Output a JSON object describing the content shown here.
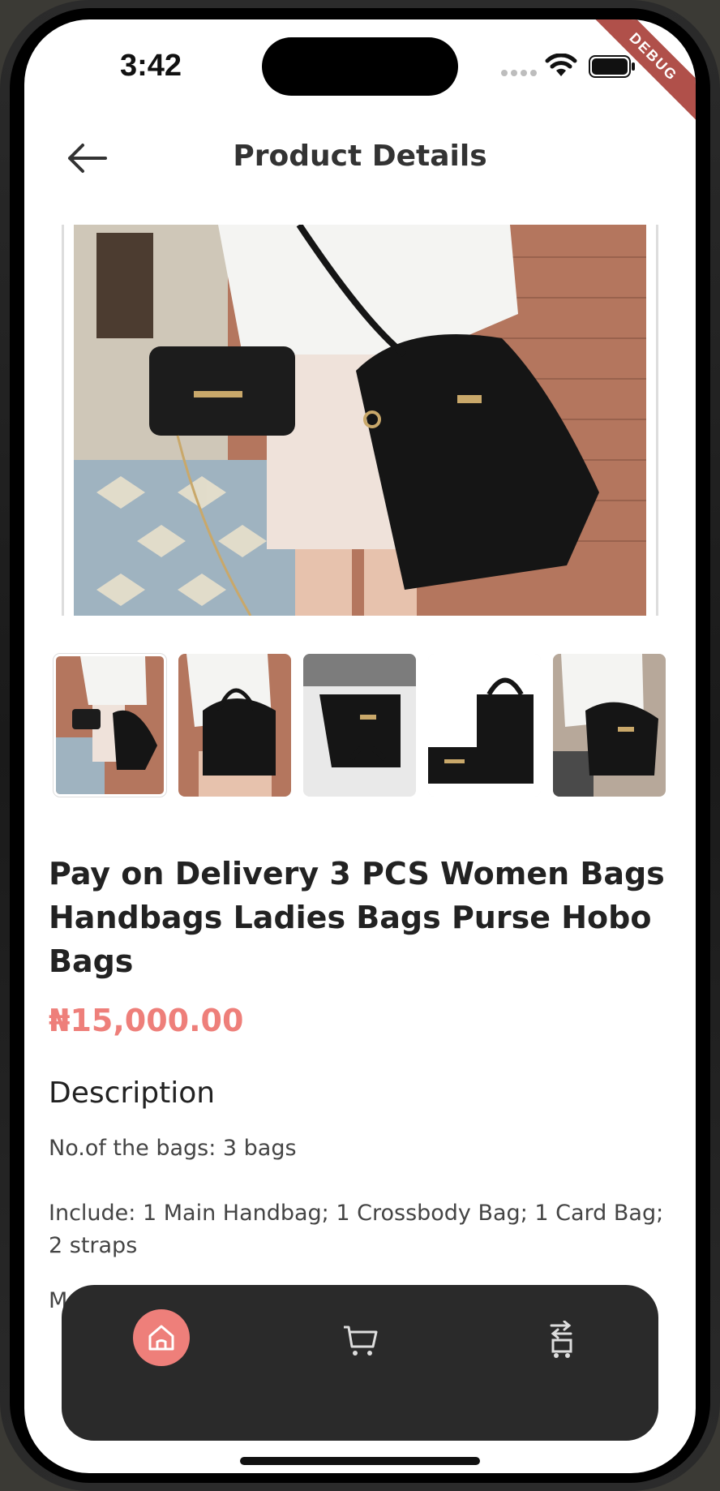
{
  "status_bar": {
    "time": "3:42",
    "debug_label": "DEBUG"
  },
  "header": {
    "title": "Product Details",
    "back_icon": "arrow-left-icon"
  },
  "gallery": {
    "main_image": "black-handbags-photo",
    "thumbnails": [
      {
        "name": "thumbnail-1",
        "selected": true
      },
      {
        "name": "thumbnail-2",
        "selected": false
      },
      {
        "name": "thumbnail-3",
        "selected": false
      },
      {
        "name": "thumbnail-4",
        "selected": false
      },
      {
        "name": "thumbnail-5",
        "selected": false
      }
    ]
  },
  "product": {
    "title": "Pay on Delivery 3 PCS Women Bags Handbags Ladies Bags Purse Hobo Bags",
    "price": "₦15,000.00",
    "description_heading": "Description",
    "description_lines": [
      "No.of the bags: 3 bags",
      "Include: 1 Main Handbag; 1 Crossbody Bag; 1 Card Bag; 2 straps",
      "M"
    ]
  },
  "bottom_nav": {
    "items": [
      {
        "name": "home",
        "icon": "home-icon",
        "active": true
      },
      {
        "name": "cart",
        "icon": "cart-icon",
        "active": false
      },
      {
        "name": "orders",
        "icon": "orders-cart-icon",
        "active": false
      }
    ]
  },
  "colors": {
    "accent": "#ee7f7a",
    "nav_background": "#2a2a2a",
    "text": "#222222"
  }
}
